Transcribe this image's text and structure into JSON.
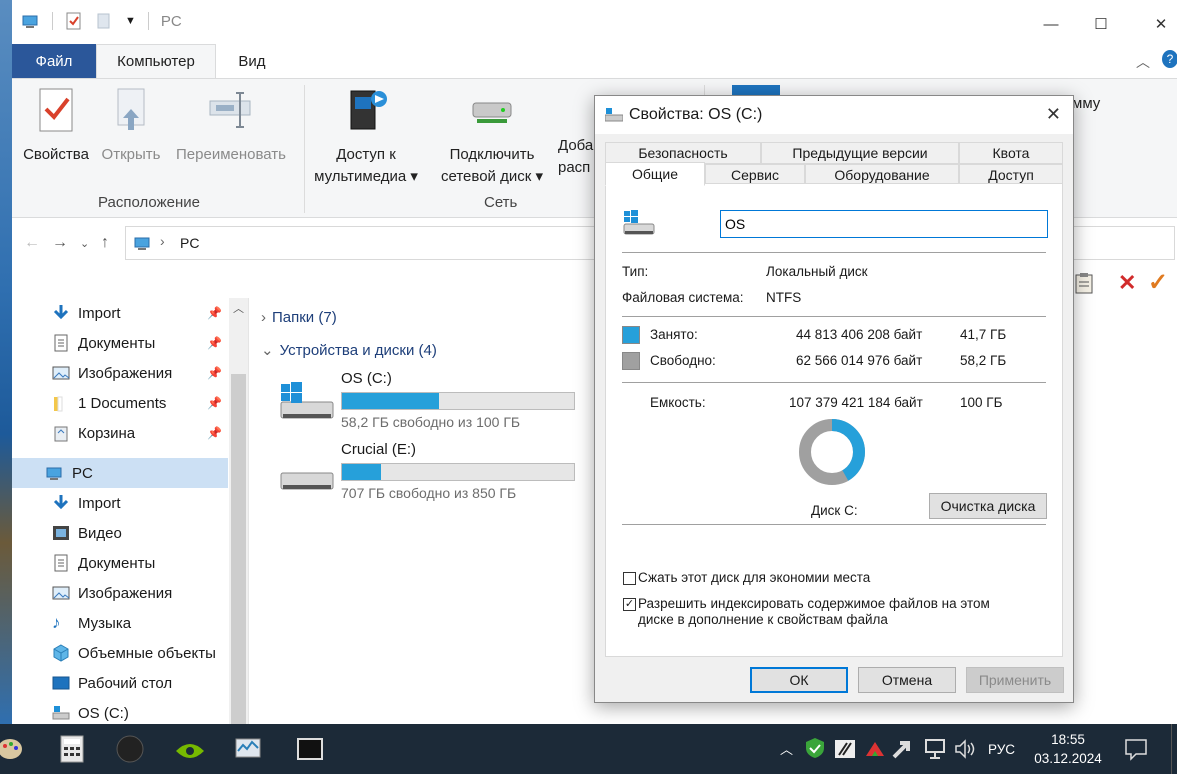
{
  "window": {
    "title": "PC"
  },
  "ribbon": {
    "tabs": [
      "Файл",
      "Компьютер",
      "Вид"
    ],
    "buttons": {
      "properties": "Свойства",
      "open": "Открыть",
      "rename": "Переименовать",
      "media_line1": "Доступ к",
      "media_line2": "мультимедиа",
      "map_line1": "Подключить",
      "map_line2": "сетевой диск",
      "add_line1": "Доба",
      "add_line2": "расп",
      "right_partial": "мму"
    },
    "groups": {
      "location": "Расположение",
      "network": "Сеть"
    }
  },
  "address": {
    "path": "PC"
  },
  "navpane": {
    "items": [
      {
        "label": "Import",
        "pinned": true
      },
      {
        "label": "Документы",
        "pinned": true
      },
      {
        "label": "Изображения",
        "pinned": true
      },
      {
        "label": "1 Documents",
        "pinned": true
      },
      {
        "label": "Корзина",
        "pinned": true
      },
      {
        "label": "PC",
        "selected": true
      },
      {
        "label": "Import"
      },
      {
        "label": "Видео"
      },
      {
        "label": "Документы"
      },
      {
        "label": "Изображения"
      },
      {
        "label": "Музыка"
      },
      {
        "label": "Объемные объекты"
      },
      {
        "label": "Рабочий стол"
      },
      {
        "label": "OS (C:)"
      }
    ]
  },
  "content": {
    "folders_header": "Папки (7)",
    "devices_header": "Устройства и диски (4)",
    "drives": [
      {
        "name": "OS (C:)",
        "free_text": "58,2 ГБ свободно из 100 ГБ",
        "used_fraction": 0.418
      },
      {
        "name": "Crucial (E:)",
        "free_text": "707 ГБ свободно из 850 ГБ",
        "used_fraction": 0.168
      }
    ]
  },
  "dialog": {
    "title": "Свойства: OS (C:)",
    "tabs_row1": [
      "Безопасность",
      "Предыдущие версии",
      "Квота"
    ],
    "tabs_row2": [
      "Общие",
      "Сервис",
      "Оборудование",
      "Доступ"
    ],
    "name_value": "OS",
    "type_label": "Тип:",
    "type_value": "Локальный диск",
    "fs_label": "Файловая система:",
    "fs_value": "NTFS",
    "used_label": "Занято:",
    "used_bytes": "44 813 406 208 байт",
    "used_gb": "41,7 ГБ",
    "free_label": "Свободно:",
    "free_bytes": "62 566 014 976 байт",
    "free_gb": "58,2 ГБ",
    "capacity_label": "Емкость:",
    "capacity_bytes": "107 379 421 184 байт",
    "capacity_gb": "100 ГБ",
    "used_fraction": 0.417,
    "disk_label": "Диск C:",
    "cleanup_button": "Очистка диска",
    "compress_label": "Сжать этот диск для экономии места",
    "compress_checked": false,
    "index_label_line1": "Разрешить индексировать содержимое файлов на этом",
    "index_label_line2": "диске в дополнение к свойствам файла",
    "index_checked": true,
    "ok": "ОК",
    "cancel": "Отмена",
    "apply": "Применить",
    "colors": {
      "used": "#26a0da",
      "free": "#a0a0a0"
    }
  },
  "taskbar": {
    "lang": "РУС",
    "time": "18:55",
    "date": "03.12.2024"
  }
}
